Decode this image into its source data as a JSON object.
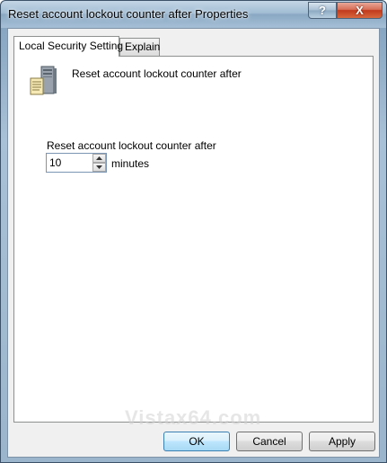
{
  "window": {
    "title": "Reset account lockout counter after Properties",
    "help_glyph": "?",
    "close_glyph": "X"
  },
  "tabs": [
    {
      "label": "Local Security Setting",
      "active": true
    },
    {
      "label": "Explain",
      "active": false
    }
  ],
  "policy": {
    "title": "Reset account lockout counter after",
    "icon": "server-icon"
  },
  "field": {
    "label": "Reset account lockout counter after",
    "value": "10",
    "unit": "minutes"
  },
  "watermark": "Vistax64.com",
  "buttons": {
    "ok": "OK",
    "cancel": "Cancel",
    "apply": "Apply"
  },
  "colors": {
    "close_button": "#c1391c",
    "default_button_border": "#3c7fb1"
  }
}
